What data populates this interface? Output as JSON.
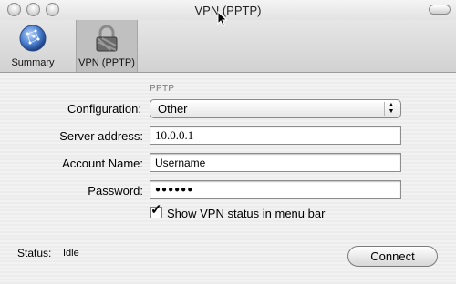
{
  "window": {
    "title": "VPN (PPTP)"
  },
  "toolbar": {
    "items": [
      {
        "label": "Summary",
        "icon": "network-globe-icon",
        "selected": false
      },
      {
        "label": "VPN (PPTP)",
        "icon": "lock-icon",
        "selected": true
      }
    ]
  },
  "form": {
    "section_title": "PPTP",
    "configuration": {
      "label": "Configuration:",
      "value": "Other"
    },
    "server_address": {
      "label": "Server address:",
      "value": "10.0.0.1"
    },
    "account_name": {
      "label": "Account Name:",
      "value": "Username"
    },
    "password": {
      "label": "Password:",
      "value": "●●●●●●"
    },
    "show_status": {
      "label": "Show VPN status in menu bar",
      "checked": true
    }
  },
  "footer": {
    "status_label": "Status:",
    "status_value": "Idle",
    "connect_label": "Connect"
  },
  "colors": {
    "toolbar_selected": "#c0c0c0",
    "stripes": "#ececec"
  }
}
